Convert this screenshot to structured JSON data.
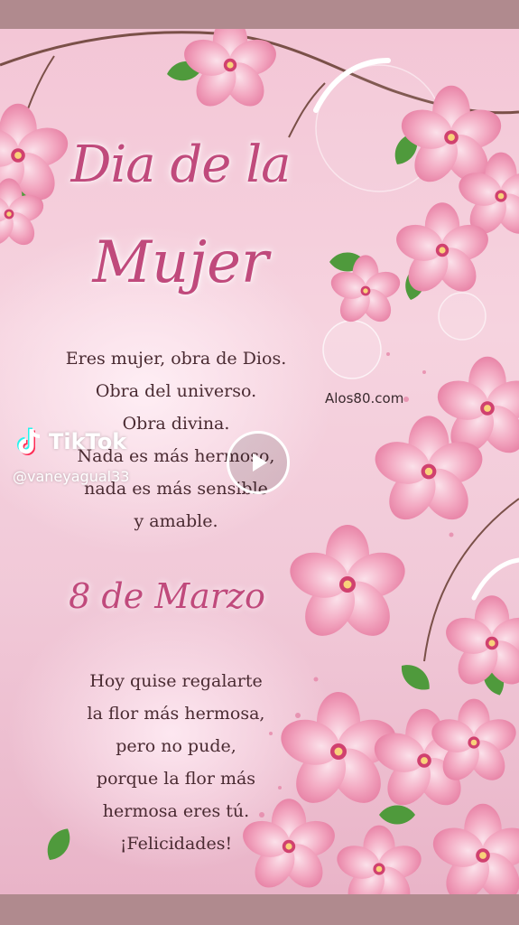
{
  "card": {
    "title_line1": "Dia de la",
    "title_line2": "Mujer",
    "poem_lines": [
      "Eres mujer, obra de Dios.",
      "Obra del universo.",
      "Obra divina.",
      "Nada es más hermoso,",
      "nada es más sensible",
      "y amable."
    ],
    "date": "8 de Marzo",
    "closing_lines": [
      "Hoy quise regalarte",
      "la flor más hermosa,",
      "pero no pude,",
      "porque la flor más",
      "hermosa eres tú.",
      "¡Felicidades!"
    ],
    "site_watermark": "Alos80.com"
  },
  "overlay": {
    "brand": "TikTok",
    "username": "@vaneyagual33",
    "play_icon": "play-icon"
  },
  "colors": {
    "title_pink": "#c04a7c",
    "text": "#4a2b32",
    "frame": "#b08a8e"
  }
}
